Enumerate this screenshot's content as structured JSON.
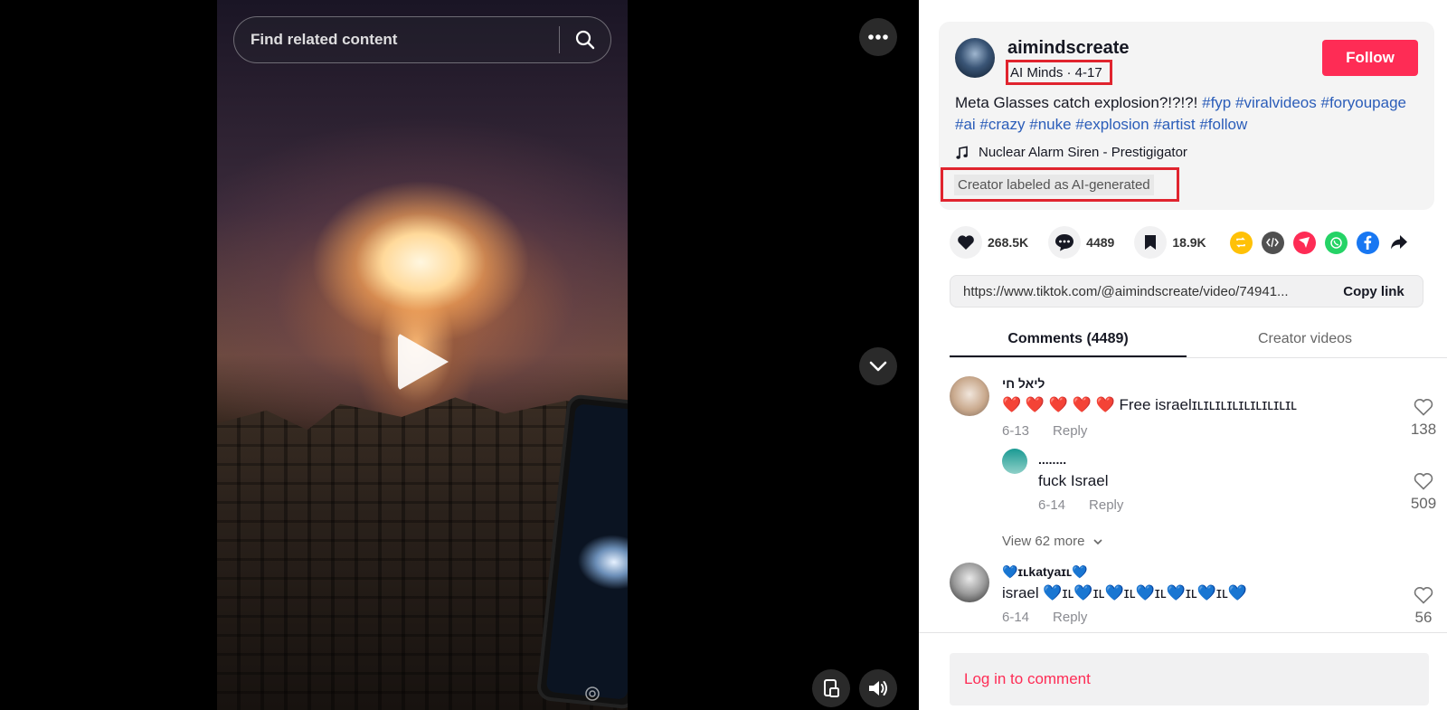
{
  "search": {
    "placeholder": "Find related content"
  },
  "author": {
    "username": "aimindscreate",
    "display_name_date": "AI Minds · 4-17",
    "follow_label": "Follow"
  },
  "description": {
    "text": "Meta Glasses catch explosion?!?!?!",
    "hashtags": [
      "#fyp",
      "#viralvideos",
      "#foryoupage",
      "#ai",
      "#crazy",
      "#nuke",
      "#explosion",
      "#artist",
      "#follow"
    ]
  },
  "music": {
    "title": "Nuclear Alarm Siren - Prestigigator"
  },
  "ai_label": "Creator labeled as AI-generated",
  "stats": {
    "likes": "268.5K",
    "comments": "4489",
    "saves": "18.9K"
  },
  "share_icons": [
    "repost-icon",
    "embed-icon",
    "send-icon",
    "whatsapp-icon",
    "facebook-icon",
    "share-arrow-icon"
  ],
  "colors": {
    "follow": "#fe2c55",
    "hashtag": "#2b5db9",
    "highlight_box": "#e0242e"
  },
  "link": {
    "url": "https://www.tiktok.com/@aimindscreate/video/74941...",
    "copy_label": "Copy link"
  },
  "tabs": [
    "Comments (4489)",
    "Creator videos"
  ],
  "comments": [
    {
      "name": "ליאל חי",
      "text": "❤️ ❤️ ❤️ ❤️ ❤️ Free israelɪʟɪʟɪʟɪʟɪʟɪʟɪʟɪʟɪʟ",
      "date": "6-13",
      "reply": "Reply",
      "likes": "138"
    },
    {
      "name": "........",
      "text": "fuck Israel",
      "date": "6-14",
      "reply": "Reply",
      "likes": "509"
    },
    {
      "name": "💙ɪʟkatyaɪʟ💙",
      "text": "israel 💙ɪʟ💙ɪʟ💙ɪʟ💙ɪʟ💙ɪʟ💙ɪʟ💙",
      "date": "6-14",
      "reply": "Reply",
      "likes": "56"
    }
  ],
  "view_more": "View 62 more",
  "login_prompt": "Log in to comment"
}
